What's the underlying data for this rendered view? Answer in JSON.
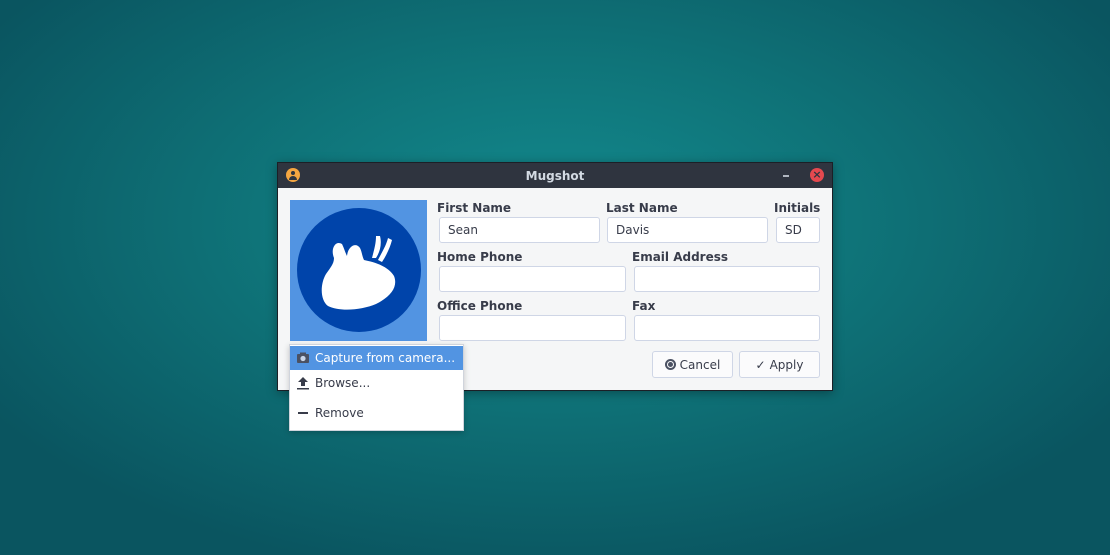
{
  "window": {
    "title": "Mugshot",
    "icon": "user-icon",
    "controls": {
      "minimize": "minimize-icon",
      "close": "close-icon",
      "close_glyph": "×"
    }
  },
  "form": {
    "first_name": {
      "label": "First Name",
      "value": "Sean",
      "placeholder": ""
    },
    "last_name": {
      "label": "Last Name",
      "value": "Davis",
      "placeholder": ""
    },
    "initials": {
      "label": "Initials",
      "value": "SD",
      "placeholder": ""
    },
    "home_phone": {
      "label": "Home Phone",
      "value": "",
      "placeholder": ""
    },
    "email": {
      "label": "Email Address",
      "value": "",
      "placeholder": ""
    },
    "office_phone": {
      "label": "Office Phone",
      "value": "",
      "placeholder": ""
    },
    "fax": {
      "label": "Fax",
      "value": "",
      "placeholder": ""
    }
  },
  "buttons": {
    "cancel": {
      "label": "Cancel",
      "icon": "cancel-icon"
    },
    "apply": {
      "label": "Apply",
      "icon": "check-icon",
      "glyph": "✓"
    }
  },
  "avatar_menu": {
    "items": [
      {
        "label": "Capture from camera...",
        "icon": "camera-icon",
        "selected": true
      },
      {
        "label": "Browse...",
        "icon": "upload-icon",
        "selected": false
      },
      {
        "label": "Remove",
        "icon": "minus-icon",
        "selected": false
      }
    ]
  },
  "colors": {
    "accent": "#5294e2",
    "avatar_circle": "#0044aa",
    "titlebar": "#2f343f",
    "close": "#e5494f",
    "app_icon": "#f5a641"
  }
}
